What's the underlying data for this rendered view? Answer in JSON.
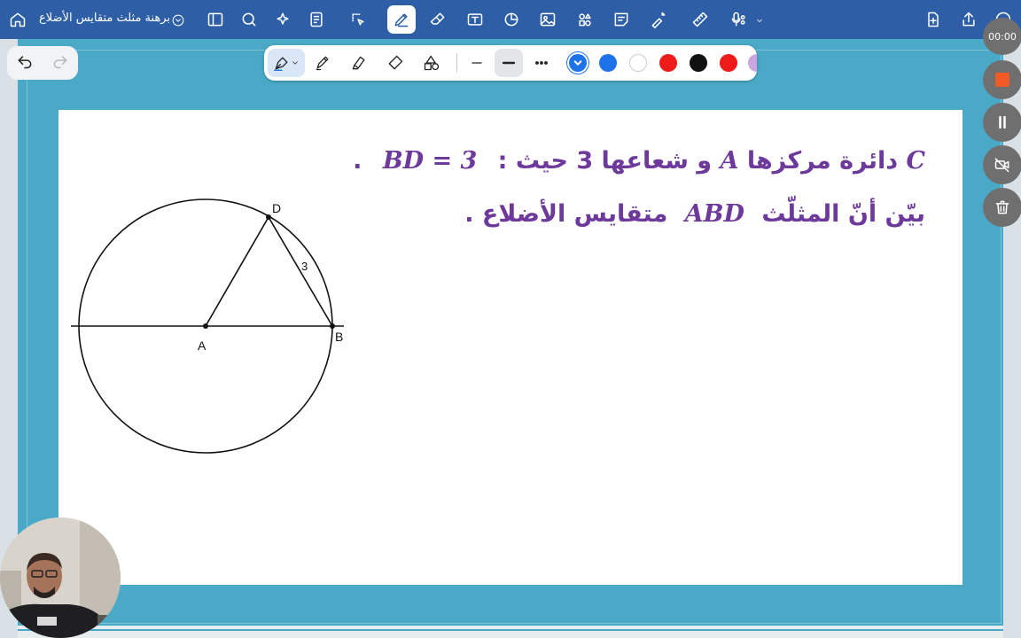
{
  "app": {
    "document_title": "برهنة مثلث متقايس الأضلاع"
  },
  "toolbar": {
    "icons": [
      "home-icon",
      "sidebar-icon",
      "search-icon",
      "sparkle-icon",
      "note-icon",
      "lasso-icon",
      "pen-icon",
      "eraser-icon",
      "textbox-icon",
      "shapes-icon",
      "image-icon",
      "elements-icon",
      "sticky-note-icon",
      "laser-icon",
      "ruler-icon",
      "microphone-icon",
      "add-page-icon",
      "share-icon",
      "more-icon"
    ]
  },
  "pen_toolbar": {
    "tools": [
      "pen",
      "highlighter",
      "fill",
      "eraser",
      "shapes"
    ],
    "stroke_widths": [
      "thin",
      "medium",
      "dots"
    ],
    "colors": [
      "#1e73e8",
      "#1e73e8",
      "#ffffff",
      "#ee1b1b",
      "#111111",
      "#ee1b1b",
      "#c9a6dd"
    ],
    "selected_color": "#1e73e8"
  },
  "recording": {
    "time": "00:00"
  },
  "problem": {
    "line1_a": "C",
    "line1_b": "دائرة مركزها",
    "line1_c": "A",
    "line1_d": "و شعاعها 3 حيث :",
    "line1_e": "BD = 3",
    "line1_f": ".",
    "line2_a": "بيّن أنّ المثلّث",
    "line2_b": "ABD",
    "line2_c": "متقايس الأضلاع ."
  },
  "figure": {
    "point_a": "A",
    "point_b": "B",
    "point_d": "D",
    "segment_label": "3"
  },
  "colors": {
    "topbar": "#2e5fa6",
    "canvas_bg": "#4aa9c6",
    "text_purple": "#6d3a9c"
  }
}
